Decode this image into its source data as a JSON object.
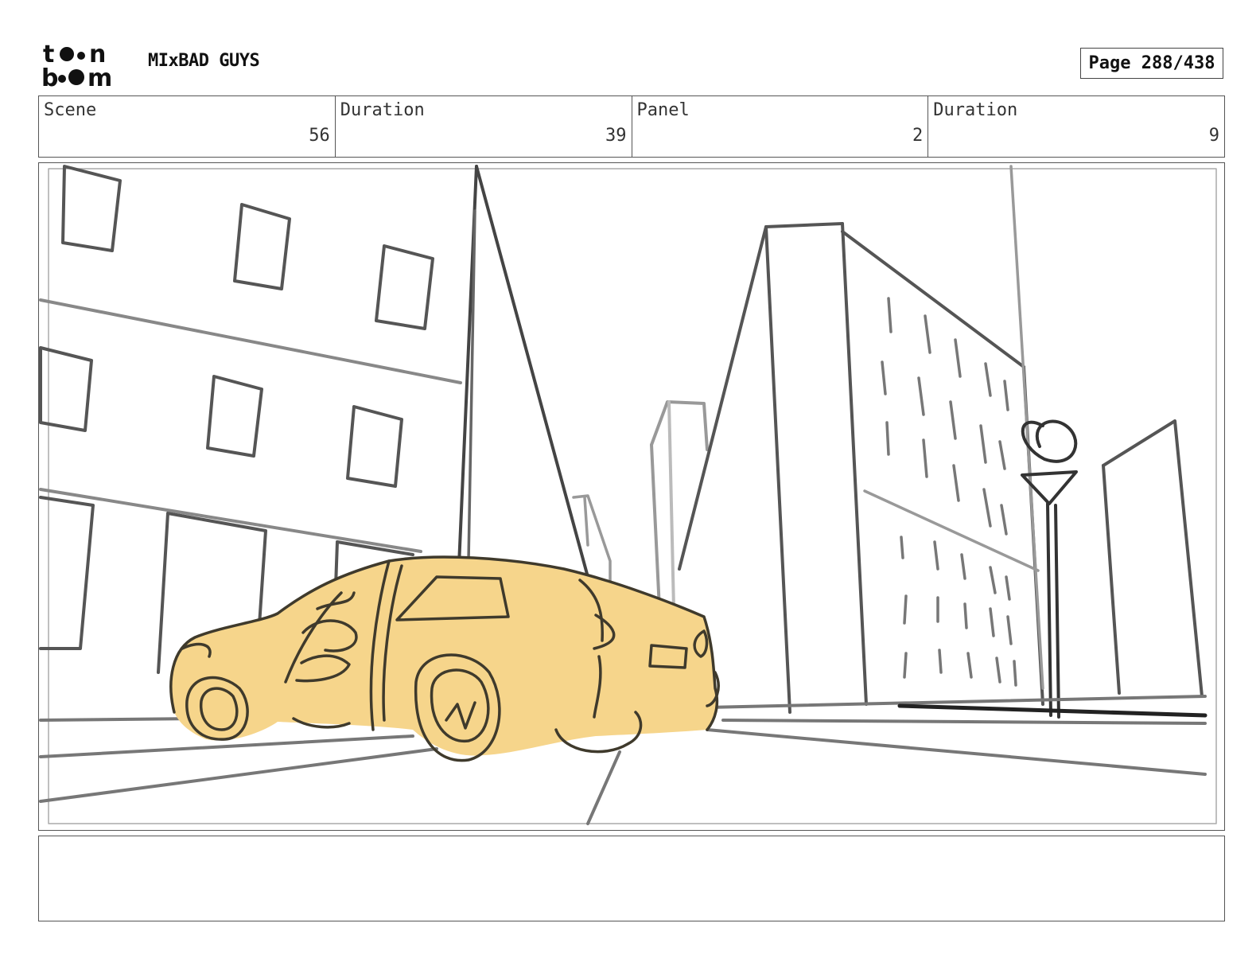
{
  "header": {
    "logo_text_top": "toon",
    "logo_text_bottom": "boom",
    "project_title": "MIxBAD GUYS",
    "page_label": "Page 288/438"
  },
  "info_row": [
    {
      "label": "Scene",
      "value": "56"
    },
    {
      "label": "Duration",
      "value": "39"
    },
    {
      "label": "Panel",
      "value": "2"
    },
    {
      "label": "Duration",
      "value": "9"
    }
  ],
  "panel": {
    "description": "",
    "car_color": "#f6d58b",
    "line_color": "#444444"
  },
  "notes": {
    "text": ""
  }
}
